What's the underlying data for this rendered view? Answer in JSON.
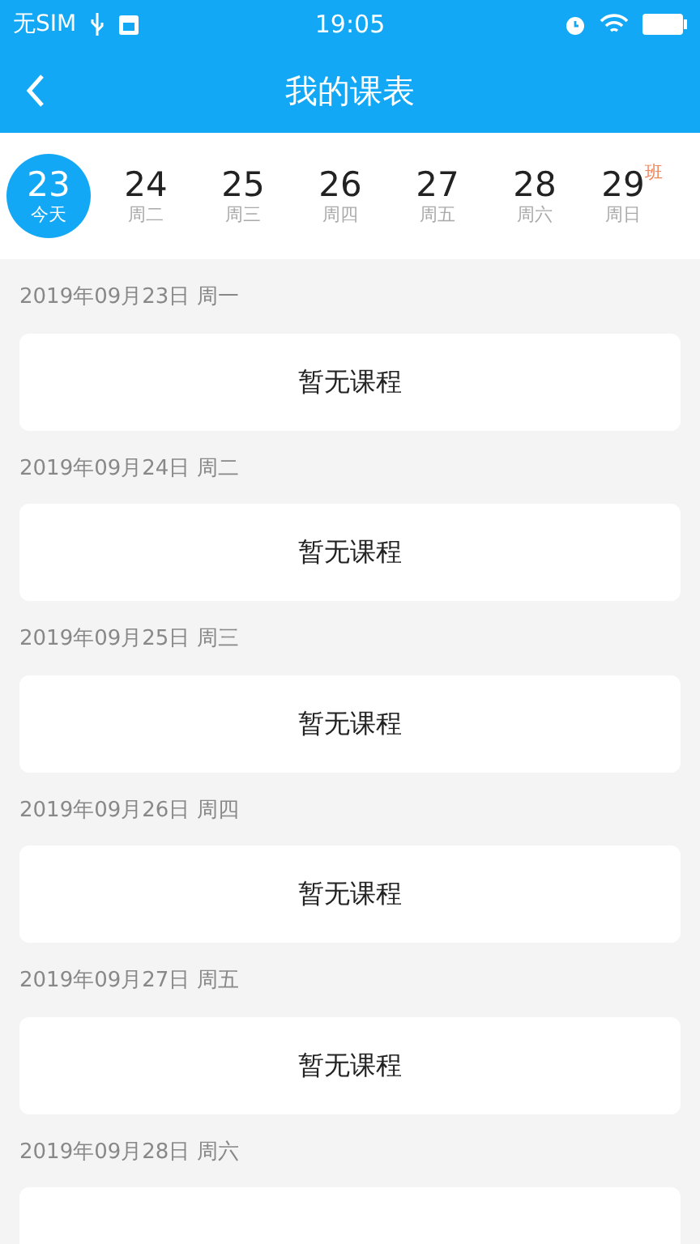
{
  "status_bar": {
    "carrier": "无SIM",
    "time": "19:05"
  },
  "nav": {
    "title": "我的课表"
  },
  "days": [
    {
      "date": "23",
      "label": "今天",
      "selected": true
    },
    {
      "date": "24",
      "label": "周二",
      "selected": false
    },
    {
      "date": "25",
      "label": "周三",
      "selected": false
    },
    {
      "date": "26",
      "label": "周四",
      "selected": false
    },
    {
      "date": "27",
      "label": "周五",
      "selected": false
    },
    {
      "date": "28",
      "label": "周六",
      "selected": false
    },
    {
      "date": "29",
      "label": "周日",
      "selected": false,
      "badge": "班"
    }
  ],
  "schedule": [
    {
      "heading": "2019年09月23日 周一",
      "text": "暂无课程"
    },
    {
      "heading": "2019年09月24日 周二",
      "text": "暂无课程"
    },
    {
      "heading": "2019年09月25日 周三",
      "text": "暂无课程"
    },
    {
      "heading": "2019年09月26日 周四",
      "text": "暂无课程"
    },
    {
      "heading": "2019年09月27日 周五",
      "text": "暂无课程"
    },
    {
      "heading": "2019年09月28日 周六"
    }
  ]
}
